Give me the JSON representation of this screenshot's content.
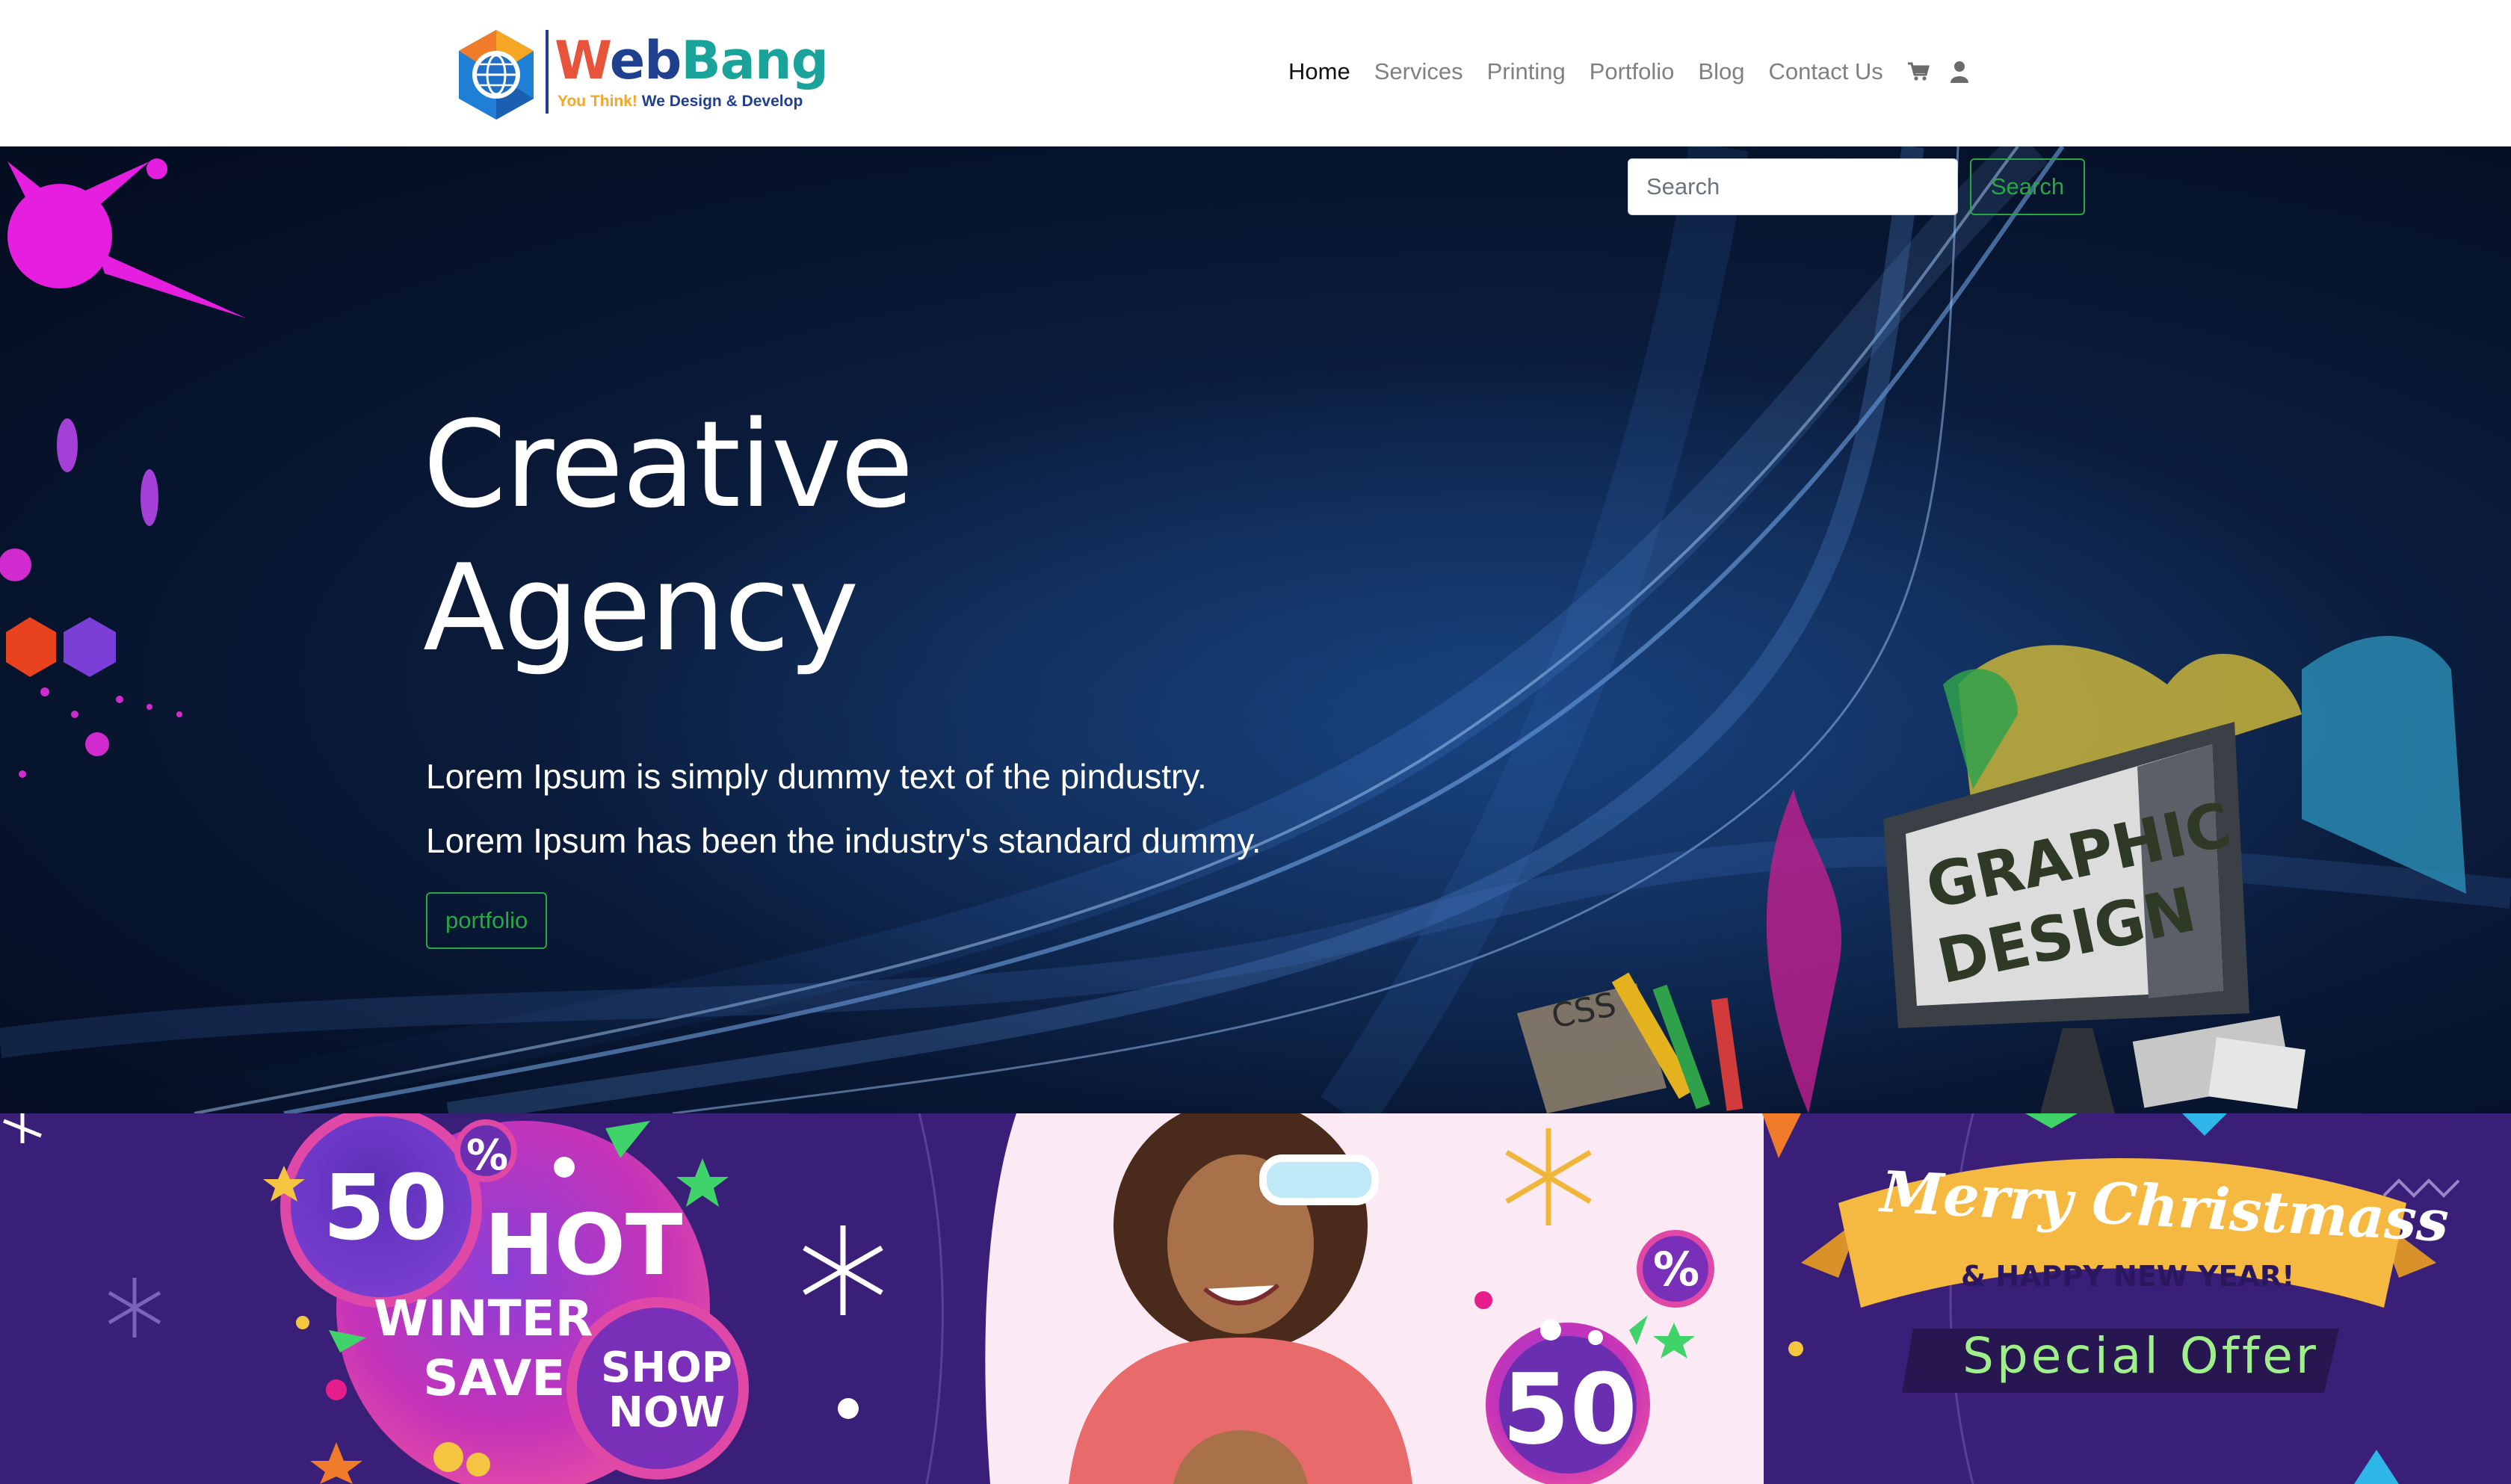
{
  "brand": {
    "name_w": "W",
    "name_eb": "eb",
    "name_bang": "Bang",
    "tagline_1": "You Think!",
    "tagline_2": "We Design & Develop"
  },
  "nav": {
    "items": [
      {
        "label": "Home",
        "active": true
      },
      {
        "label": "Services",
        "active": false
      },
      {
        "label": "Printing",
        "active": false
      },
      {
        "label": "Portfolio",
        "active": false
      },
      {
        "label": "Blog",
        "active": false
      },
      {
        "label": "Contact Us",
        "active": false
      }
    ],
    "icons": [
      "cart-icon",
      "user-icon"
    ]
  },
  "search": {
    "placeholder": "Search",
    "button_label": "Search"
  },
  "hero": {
    "title_line1": "Creative",
    "title_line2": "Agency",
    "line1": "Lorem Ipsum is simply dummy text of the pindustry.",
    "line2": "Lorem Ipsum has been the industry's standard dummy.",
    "button_label": "portfolio",
    "art_text_1": "GRAPHIC",
    "art_text_2": "DESIGN",
    "art_text_3": "CSS"
  },
  "promo": {
    "badge_50": "50",
    "percent": "%",
    "hot": "HOT",
    "winter": "WINTER",
    "save": "SAVE",
    "shop": "SHOP",
    "now": "NOW",
    "badge_50_b": "50",
    "percent_b": "%",
    "merry": "Merry Christmass",
    "new_year": "& HAPPY NEW YEAR!",
    "special": "Special Offer"
  },
  "colors": {
    "accent_green": "#28a745",
    "hero_bg": "#0b1d3e",
    "promo_bg": "#3a1f78",
    "nav_text": "#808080",
    "nav_active": "#111111"
  }
}
